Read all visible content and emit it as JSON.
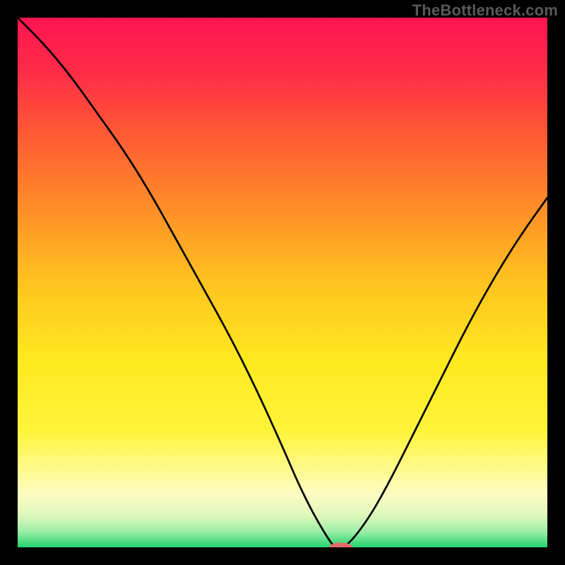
{
  "watermark": "TheBottleneck.com",
  "chart_data": {
    "type": "line",
    "title": "",
    "xlabel": "",
    "ylabel": "",
    "xlim": [
      0,
      100
    ],
    "ylim": [
      0,
      100
    ],
    "background": {
      "type": "vertical-gradient",
      "stops": [
        {
          "offset": 0,
          "color": "#ff1450"
        },
        {
          "offset": 10,
          "color": "#ff2b47"
        },
        {
          "offset": 22,
          "color": "#ff5a34"
        },
        {
          "offset": 35,
          "color": "#ff8a28"
        },
        {
          "offset": 50,
          "color": "#ffc31f"
        },
        {
          "offset": 65,
          "color": "#ffe91f"
        },
        {
          "offset": 78,
          "color": "#fff43a"
        },
        {
          "offset": 85,
          "color": "#fff98a"
        },
        {
          "offset": 90,
          "color": "#fdfcc3"
        },
        {
          "offset": 94,
          "color": "#dff7bb"
        },
        {
          "offset": 97,
          "color": "#9ceea6"
        },
        {
          "offset": 100,
          "color": "#24d36f"
        }
      ]
    },
    "series": [
      {
        "name": "bottleneck-curve",
        "color": "#000000",
        "width": 2.7,
        "x": [
          0,
          5,
          10,
          15,
          20,
          25,
          30,
          35,
          40,
          45,
          50,
          53,
          56,
          59,
          60,
          62,
          66,
          70,
          75,
          80,
          85,
          90,
          95,
          100
        ],
        "y": [
          100,
          95,
          89,
          82,
          75,
          67,
          58,
          49,
          40,
          30,
          19,
          12,
          6,
          1,
          0,
          0,
          5,
          12,
          22,
          32,
          42,
          51,
          59,
          66
        ]
      }
    ],
    "marker": {
      "name": "optimal-marker",
      "shape": "capsule",
      "color": "#e26a6a",
      "x": 61,
      "y": 0,
      "rx": 2.2,
      "ry": 0.9
    }
  }
}
